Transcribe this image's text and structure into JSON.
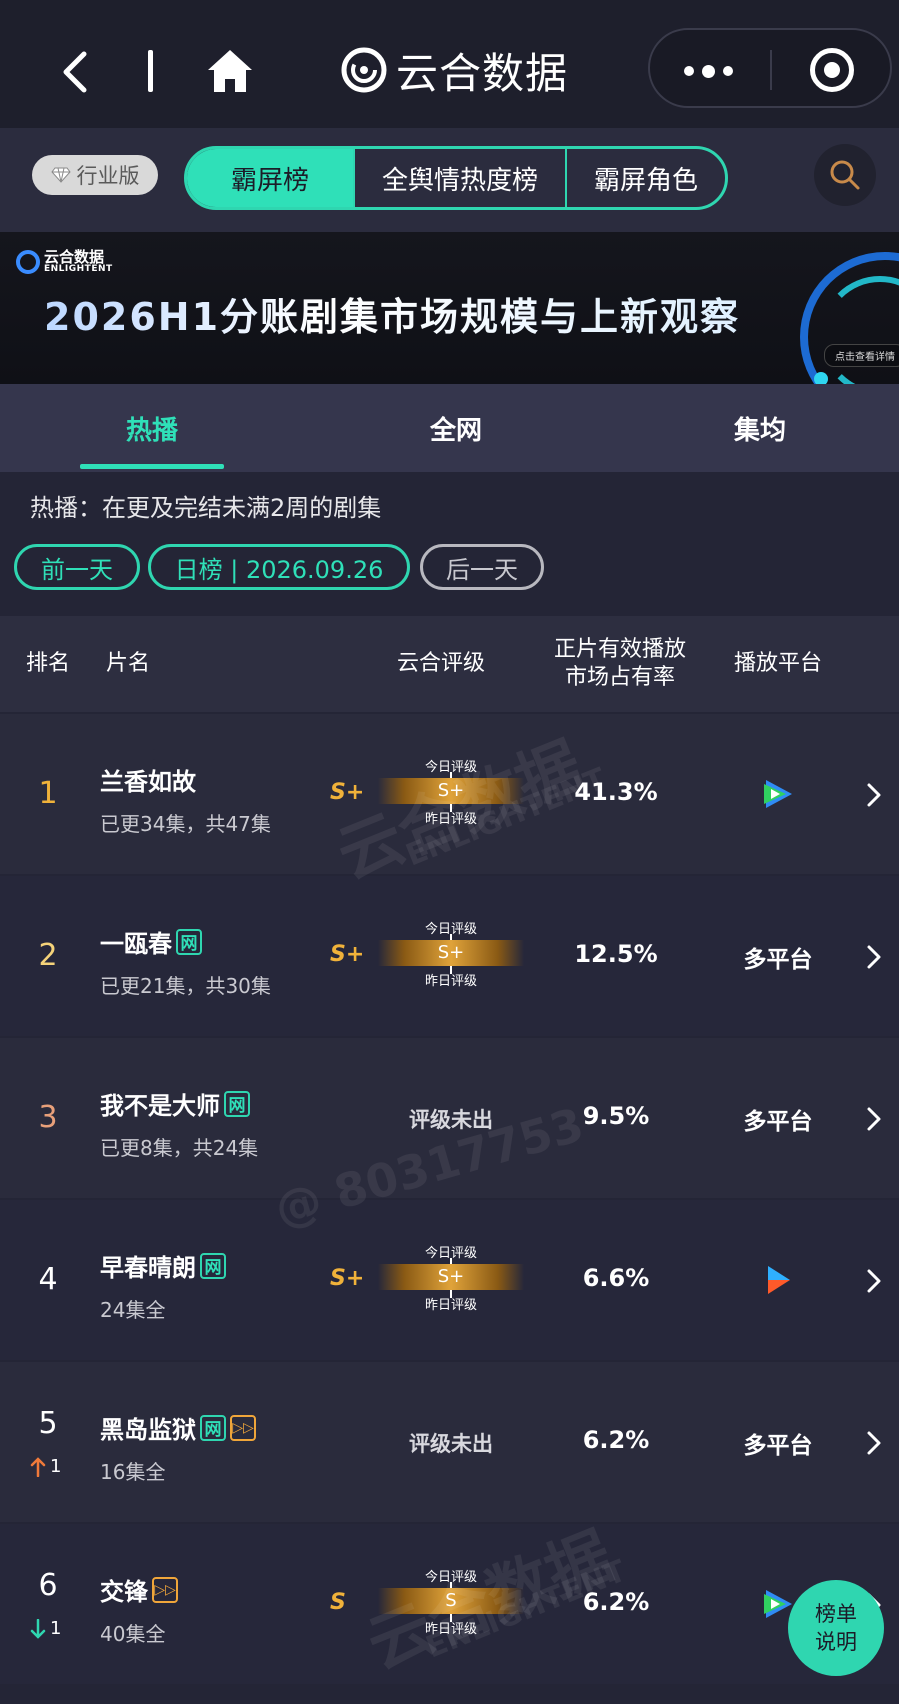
{
  "nav": {
    "app_title": "云合数据"
  },
  "category_bar": {
    "industry_label": "行业版",
    "tabs": [
      "霸屏榜",
      "全舆情热度榜",
      "霸屏角色"
    ],
    "active_tab": "霸屏榜"
  },
  "banner": {
    "logo_cn": "云合数据",
    "logo_en": "ENLIGHTENT",
    "title": "2026H1分账剧集市场规模与上新观察",
    "cta": "点击查看详情"
  },
  "view_tabs": [
    "热播",
    "全网",
    "集均"
  ],
  "active_view_tab": "热播",
  "description": "热播：在更及完结未满2周的剧集",
  "date_nav": {
    "prev_label": "前一天",
    "current_label": "日榜 | 2026.09.26",
    "next_label": "后一天"
  },
  "table": {
    "headers": {
      "rank": "排名",
      "title": "片名",
      "grade": "云合评级",
      "share_line1": "正片有效播放",
      "share_line2": "市场占有率",
      "platform": "播放平台"
    },
    "grade_labels": {
      "today": "今日评级",
      "yesterday": "昨日评级"
    },
    "rows": [
      {
        "rank": "1",
        "rank_color": "#f0b23a",
        "title": "兰香如故",
        "badges": [],
        "episodes": "已更34集，共47集",
        "grade": "S+",
        "share": "41.3%",
        "platform_text": "",
        "platform_icon": "tencent-video-icon"
      },
      {
        "rank": "2",
        "rank_color": "#f5d37a",
        "title": "一瓯春",
        "badges": [
          "网"
        ],
        "episodes": "已更21集，共30集",
        "grade": "S+",
        "share": "12.5%",
        "platform_text": "多平台",
        "platform_icon": ""
      },
      {
        "rank": "3",
        "rank_color": "#e8a07a",
        "title": "我不是大师",
        "badges": [
          "网"
        ],
        "episodes": "已更8集，共24集",
        "grade": "评级未出",
        "share": "9.5%",
        "platform_text": "多平台",
        "platform_icon": ""
      },
      {
        "rank": "4",
        "rank_color": "#ffffff",
        "title": "早春晴朗",
        "badges": [
          "网"
        ],
        "episodes": "24集全",
        "grade": "S+",
        "share": "6.6%",
        "platform_text": "",
        "platform_icon": "youku-icon"
      },
      {
        "rank": "5",
        "rank_color": "#ffffff",
        "rank_change": "1",
        "rank_dir": "up",
        "title": "黑岛监狱",
        "badges": [
          "网",
          "play"
        ],
        "episodes": "16集全",
        "grade": "评级未出",
        "share": "6.2%",
        "platform_text": "多平台",
        "platform_icon": ""
      },
      {
        "rank": "6",
        "rank_color": "#ffffff",
        "rank_change": "1",
        "rank_dir": "down",
        "title": "交锋",
        "badges": [
          "play"
        ],
        "episodes": "40集全",
        "grade": "S",
        "share": "6.2%",
        "platform_text": "",
        "platform_icon": "tencent-video-icon"
      }
    ]
  },
  "badge_net_text": "网",
  "float_button": {
    "line1": "榜单",
    "line2": "说明"
  },
  "watermark": {
    "brand": "云合数据",
    "brand_en": "ENLIGHTENT",
    "user_id": "@ 80317753"
  }
}
